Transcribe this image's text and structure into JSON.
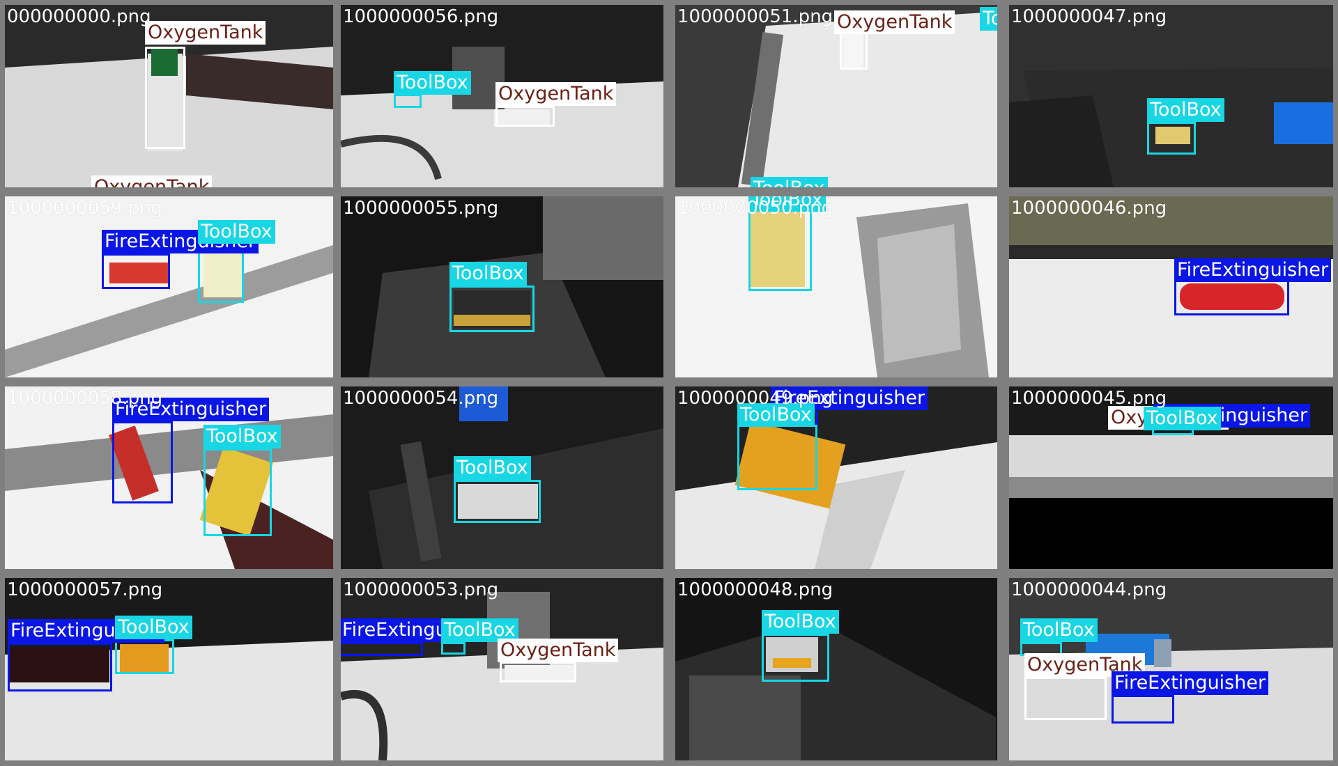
{
  "colors": {
    "ToolBox": "#18d6e4",
    "FireExtinguisher": "#0a16e6",
    "OxygenTank": "#ffffff",
    "OxygenTank_text": "#6a1f14",
    "border": "#7f7f7f"
  },
  "tiles": [
    {
      "filename": "000000000.png",
      "labels": [
        "OxygenTank",
        "OxygenTank"
      ]
    },
    {
      "filename": "1000000056.png",
      "labels": [
        "ToolBox",
        "OxygenTank"
      ]
    },
    {
      "filename": "1000000051.png",
      "labels": [
        "OxygenTank",
        "ToolBox",
        "ToolBox"
      ]
    },
    {
      "filename": "1000000047.png",
      "labels": [
        "ToolBox"
      ]
    },
    {
      "filename": "1000000059.png",
      "labels": [
        "FireExtinguisher",
        "ToolBox"
      ]
    },
    {
      "filename": "1000000055.png",
      "labels": [
        "ToolBox"
      ]
    },
    {
      "filename": "1000000050.png",
      "labels": [
        "ToolBox"
      ]
    },
    {
      "filename": "1000000046.png",
      "labels": [
        "FireExtinguisher"
      ]
    },
    {
      "filename": "1000000058.png",
      "labels": [
        "FireExtinguisher",
        "ToolBox"
      ]
    },
    {
      "filename": "1000000054.png",
      "labels": [
        "ToolBox"
      ]
    },
    {
      "filename": "1000000049.png",
      "labels": [
        "FireExtinguisher",
        "ToolBox"
      ]
    },
    {
      "filename": "1000000045.png",
      "labels": [
        "OxygenTank",
        "FireExtinguisher",
        "ToolBox"
      ]
    },
    {
      "filename": "1000000057.png",
      "labels": [
        "FireExtinguisher",
        "ToolBox"
      ]
    },
    {
      "filename": "1000000053.png",
      "labels": [
        "FireExtinguisher",
        "ToolBox",
        "OxygenTank"
      ]
    },
    {
      "filename": "1000000048.png",
      "labels": [
        "ToolBox"
      ]
    },
    {
      "filename": "1000000044.png",
      "labels": [
        "ToolBox",
        "OxygenTank",
        "FireExtinguisher"
      ]
    }
  ]
}
